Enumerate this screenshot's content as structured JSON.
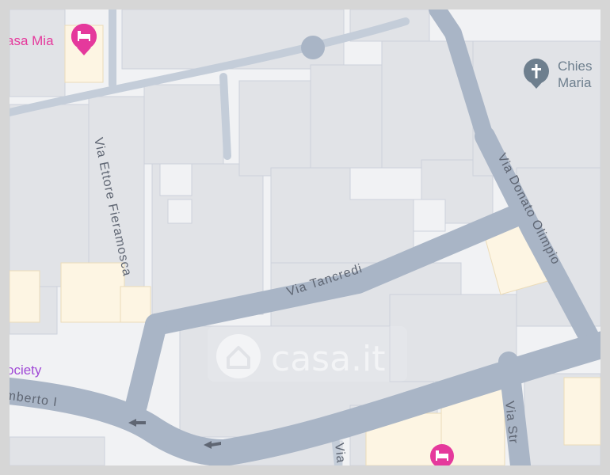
{
  "map": {
    "streets": {
      "tancredi": "Via Tancredi",
      "donato_olimpio": "Via Donato Olimpio",
      "ettore_fieramosca": "Via Ettore Fieramosca",
      "umberto": "mberto I",
      "via_str": "Via Str",
      "via_partial": "Via"
    },
    "pois": {
      "hotel_top": "asa Mia",
      "church": "Chies",
      "church_line2": "Maria",
      "society": "ociety"
    },
    "watermark": "casa.it",
    "colors": {
      "road": "#a9b5c6",
      "block": "#e1e3e7",
      "block_edge": "#c9ced8",
      "highlight": "#fdf5e3",
      "hotel": "#e5399c",
      "church": "#6e7f8e",
      "society_text": "#a049d6"
    },
    "icons": {
      "hotel": "bed-icon",
      "church": "cross-icon",
      "arrow": "one-way-arrow-icon"
    }
  }
}
